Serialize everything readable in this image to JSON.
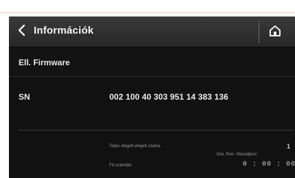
{
  "header": {
    "title": "Információk",
    "back_icon": "chevron-left-icon",
    "home_icon": "home-icon"
  },
  "rows": {
    "firmware": {
      "label": "Ell. Firmware"
    },
    "sn": {
      "label": "SN",
      "value": "002 100 40 303 951 14 383 136"
    }
  },
  "footer": {
    "line1_label": "Teljes elégett elégett száma",
    "line1_value": "1",
    "line2_label": "Fő számláló",
    "line2_meta": "Órá. Perc. Másodperc",
    "line2_value": "0 : 00 : 00"
  },
  "colors": {
    "background": "#111111",
    "header": "#2f2f2f",
    "text": "#eeeeee"
  }
}
